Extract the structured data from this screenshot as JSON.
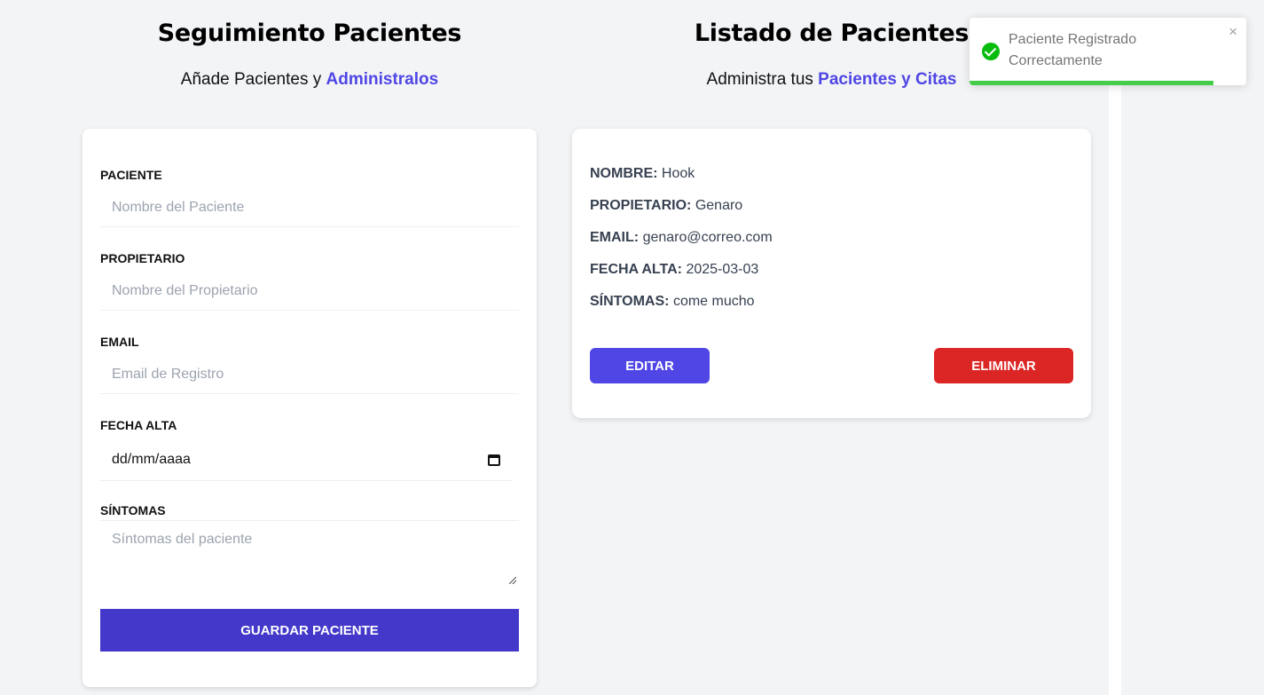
{
  "form_section": {
    "title": "Seguimiento Pacientes",
    "subtitle_prefix": "Añade Pacientes y ",
    "subtitle_accent": "Administralos"
  },
  "form": {
    "fields": [
      {
        "label": "Paciente",
        "placeholder": "Nombre del Paciente"
      },
      {
        "label": "Propietario",
        "placeholder": "Nombre del Propietario"
      },
      {
        "label": "Email",
        "placeholder": "Email de Registro"
      },
      {
        "label": "Fecha Alta",
        "value": "dd/mm/aaaa"
      },
      {
        "label": "Síntomas",
        "placeholder": "Síntomas del paciente"
      }
    ],
    "submit_label": "Guardar Paciente"
  },
  "list_section": {
    "title": "Listado de Pacientes",
    "subtitle_prefix": "Administra tus ",
    "subtitle_accent": "Pacientes y Citas"
  },
  "patient": {
    "rows": [
      {
        "key": "Nombre:",
        "value": "Hook"
      },
      {
        "key": "Propietario:",
        "value": "Genaro"
      },
      {
        "key": "Email:",
        "value": "genaro@correo.com"
      },
      {
        "key": "Fecha Alta:",
        "value": "2025-03-03"
      },
      {
        "key": "Síntomas:",
        "value": "come mucho"
      }
    ],
    "edit_label": "Editar",
    "delete_label": "Eliminar"
  },
  "toast": {
    "line1": "Paciente Registrado",
    "line2": "Correctamente",
    "close": "×",
    "icon": "check-circle-icon",
    "progress": 0.88
  },
  "colors": {
    "accent": "#4f46e5",
    "submit": "#4338ca",
    "danger": "#dc2626",
    "success": "#07bc0c"
  }
}
